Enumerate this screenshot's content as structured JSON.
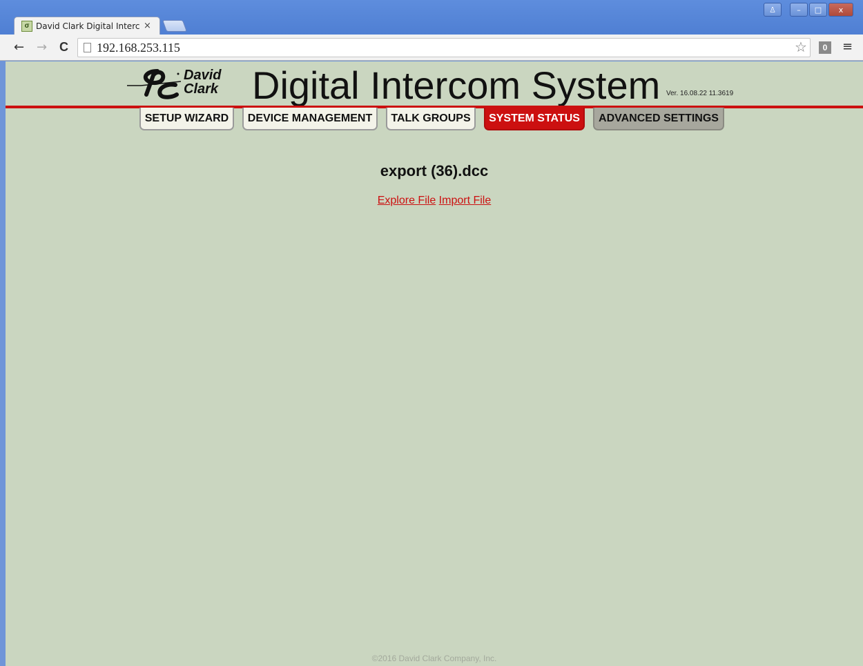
{
  "browser": {
    "tab_title": "David Clark Digital Intercom",
    "tab_close": "×",
    "url": "192.168.253.115",
    "ext_badge": "0",
    "window_controls": {
      "user": "♙",
      "minimize": "–",
      "maximize": "□",
      "close": "x"
    },
    "nav_icons": {
      "back": "←",
      "forward": "→",
      "reload": "C",
      "star": "☆",
      "menu": "≡"
    }
  },
  "header": {
    "logo_line1": "David",
    "logo_line2": "Clark",
    "title": "Digital Intercom System",
    "version": "Ver. 16.08.22 11.3619"
  },
  "nav": {
    "items": [
      {
        "label": "SETUP WIZARD"
      },
      {
        "label": "DEVICE MANAGEMENT"
      },
      {
        "label": "TALK GROUPS"
      },
      {
        "label": "SYSTEM STATUS"
      },
      {
        "label": "ADVANCED SETTINGS"
      }
    ],
    "active": "SYSTEM STATUS"
  },
  "main": {
    "file_name": "export (36).dcc",
    "explore_link": "Explore File",
    "import_link": "Import File"
  },
  "footer": {
    "copyright": "©2016 David Clark Company, Inc."
  },
  "colors": {
    "page_background": "#cad6c0",
    "accent_red": "#cc1010",
    "advanced_tab": "#a7a79d"
  }
}
